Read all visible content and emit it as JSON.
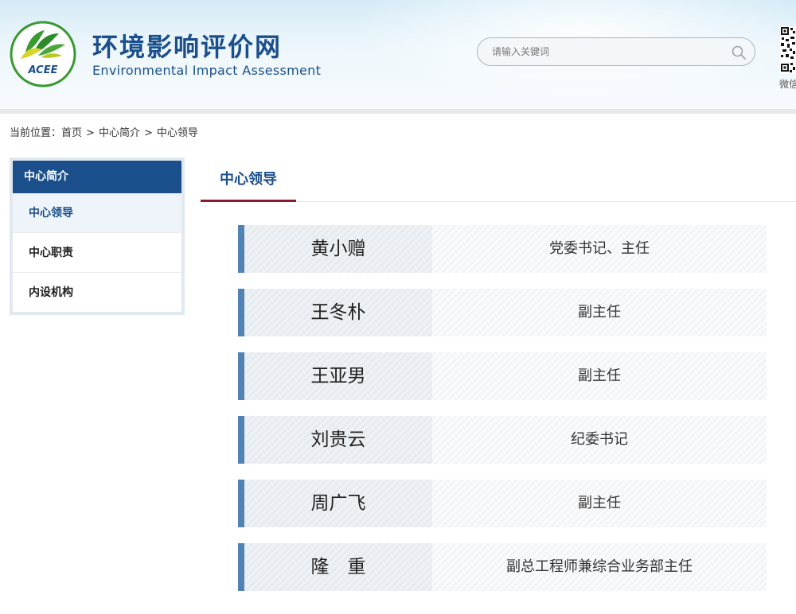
{
  "header": {
    "site_title": "环境影响评价网",
    "site_subtitle": "Environmental Impact Assessment",
    "logo_text": "ACEE",
    "search": {
      "placeholder": "请输入关键词"
    },
    "wechat_label": "微信"
  },
  "breadcrumb": {
    "prefix": "当前位置：",
    "items": [
      "首页",
      "中心简介",
      "中心领导"
    ],
    "separator": ">"
  },
  "sidebar": {
    "title": "中心简介",
    "items": [
      {
        "label": "中心领导",
        "active": true
      },
      {
        "label": "中心职责",
        "active": false
      },
      {
        "label": "内设机构",
        "active": false
      }
    ]
  },
  "main": {
    "tab_title": "中心领导",
    "leaders": [
      {
        "name": "黄小赠",
        "title": "党委书记、主任"
      },
      {
        "name": "王冬朴",
        "title": "副主任"
      },
      {
        "name": "王亚男",
        "title": "副主任"
      },
      {
        "name": "刘贵云",
        "title": "纪委书记"
      },
      {
        "name": "周广飞",
        "title": "副主任"
      },
      {
        "name": "隆　重",
        "title": "副总工程师兼综合业务部主任"
      }
    ]
  },
  "colors": {
    "brand_blue": "#1a4f8c",
    "accent_red": "#8c1b2e",
    "row_bar_blue": "#5182b4",
    "logo_green": "#3a9a32",
    "logo_yellow": "#d8d42a"
  },
  "icons": {
    "search": "search-icon",
    "logo": "acee-logo-icon",
    "qr": "qr-code-icon"
  }
}
